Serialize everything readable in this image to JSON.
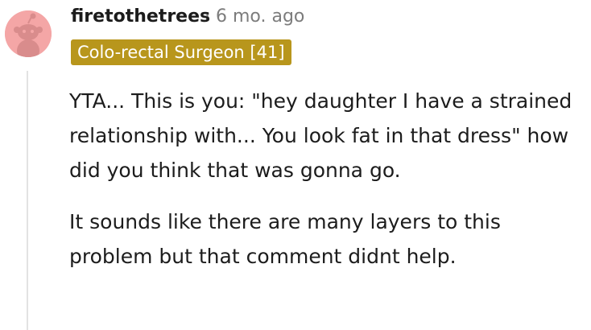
{
  "comment": {
    "author": "firetothetrees",
    "separator_timestamp": "· 6 mo. ago",
    "flair": "Colo-rectal Surgeon [41]",
    "paragraphs": [
      "YTA... This is you: \"hey daughter I have a strained relationship with... You look fat in that dress\" how did you think that was gonna go.",
      "It sounds like there are many layers to this problem but that comment didnt help."
    ]
  },
  "colors": {
    "avatar_bg": "#f4a6a6",
    "flair_bg": "#b8961c",
    "text": "#1c1c1c",
    "meta": "#7c7c7c"
  },
  "icons": {
    "avatar": "reddit-snoo-avatar-icon"
  }
}
